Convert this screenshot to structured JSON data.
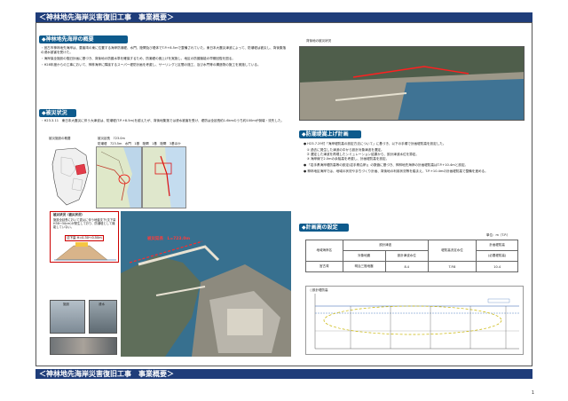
{
  "header_title": "＜神林地先海岸災害復旧工事　事業概要＞",
  "footer_title": "＜神林地先海岸災害復旧工事　事業概要＞",
  "sec_overview": {
    "title": "◆神林地先海岸の概要",
    "paragraphs": [
      "・宮古市神林地先海岸は、要害湾の東に位置する海岸防潮堤、水門、陸閘及び堤体でT.P.+8.5ｍで整備されていた。東日本大震災津波によって、防潮堤は被災し、背後集落の浸水被害を受けた。",
      "・海岸保全施設の復旧計画に基づき、背後地の防護水準を確保するため、防潮堤の嵩上げを実施し、地区の防護機能の早期回復を図る。",
      "・H28年度からの工事において、神林海岸に隣接するスーパー堤防計画を考慮し、サーリングと区間の施工、及び水門等の構造物の施工を実施している。"
    ]
  },
  "sec_damage": {
    "title": "◆被災状況",
    "paragraph": "・H23.3.11　東日本大震災に伴う大津波は、防潮堤(T.P.+8.5m)を越えたが、背後地集落では浸水被害を受け、堤防は全延長約1.6kmのうち約100mが倒壊・流失した。",
    "site_label": "被災施設の概要",
    "site_lines": [
      "被災延長　723.0m",
      "防潮堤　723.5m　水門　1基　陸閘　1基　陸閘　3基ほか"
    ],
    "callout_title": "被災状況（被災状況）",
    "callout_body": "施設全延長において震災に伴う地盤沈下(沈下量H38～50cm)が発生しており、防潮堤として機能していない。",
    "callout_tag": "沈下量 H=0.30～0.50m",
    "aerial_label": "被災延長　L=723.0m",
    "photo_label_a": "施設",
    "photo_label_b": "浸水"
  },
  "sec_photo": {
    "caption": "背後地の被災状況"
  },
  "sec_height": {
    "title": "◆防潮堤嵩上げ計画",
    "items": [
      "● H23.7.29付「海岸堤防高の設定方法について」に基づき、以下の手順で計画堤防高を設定した。",
      "　① 過去に発生した津波の中から設計対象津波を選定。",
      "　② 選定した津波を再現したシミュレーション結果から、設計津波水位を算定。",
      "　③ 海岸線で2.0mの余裕高を考慮し、計画堤防高を設定。",
      "● 「岩手県海岸堤防高等の設定(岩手県沿岸)」の数値に基づき、神林地先海岸の計画堤防高はT.P.+10.4mと設定。",
      "● 神林地区海岸では、地域の状況やまちづくり計画、背後地の利用状況等を踏まえ、T.P.+10.4mの計画堤防高で整備を進める。"
    ]
  },
  "sec_plan": {
    "title": "◆計画高の設定",
    "unit": "単位：m（T.P.）",
    "headers": [
      "地域海岸名",
      "設計津波",
      "",
      "堤防高決定水位",
      "計画堤防高"
    ],
    "subheaders": [
      "",
      "対象地震",
      "設計津波水位",
      "",
      "(必要堤防高)"
    ],
    "row": [
      "宮古湾",
      "明治三陸地震",
      "8.4",
      "T.P.8",
      "10.4"
    ],
    "chart_label": "○設計堤防高"
  },
  "page_number": "1"
}
